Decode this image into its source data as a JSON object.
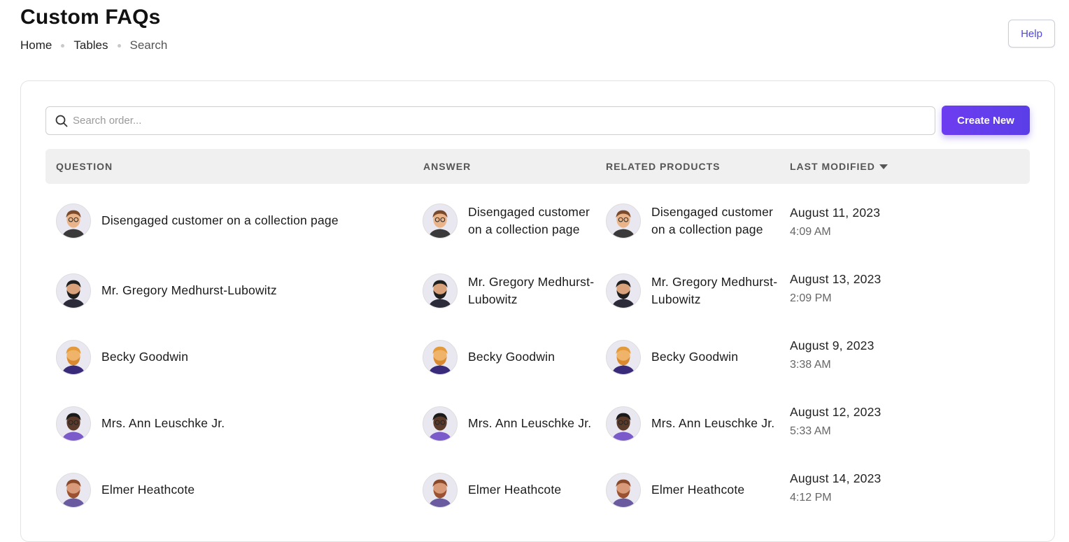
{
  "page": {
    "title": "Custom FAQs",
    "breadcrumb": [
      "Home",
      "Tables",
      "Search"
    ],
    "help_label": "Help"
  },
  "toolbar": {
    "search_placeholder": "Search order...",
    "create_label": "Create New"
  },
  "table": {
    "columns": [
      "QUESTION",
      "ANSWER",
      "RELATED PRODUCTS",
      "LAST MODIFIED"
    ],
    "rows": [
      {
        "question": "Disengaged customer on a collection page",
        "answer": "Disengaged customer on a collection page",
        "related": "Disengaged customer on a collection page",
        "date": "August 11, 2023",
        "time": "4:09 AM",
        "avatar": "man-brown-hair-glasses"
      },
      {
        "question": "Mr. Gregory Medhurst-Lubowitz",
        "answer": "Mr. Gregory Medhurst-Lubowitz",
        "related": "Mr. Gregory Medhurst-Lubowitz",
        "date": "August 13, 2023",
        "time": "2:09 PM",
        "avatar": "man-black-beard"
      },
      {
        "question": "Becky Goodwin",
        "answer": "Becky Goodwin",
        "related": "Becky Goodwin",
        "date": "August 9, 2023",
        "time": "3:38 AM",
        "avatar": "man-blond-beard"
      },
      {
        "question": "Mrs. Ann Leuschke Jr.",
        "answer": "Mrs. Ann Leuschke Jr.",
        "related": "Mrs. Ann Leuschke Jr.",
        "date": "August 12, 2023",
        "time": "5:33 AM",
        "avatar": "man-dark-skin-glasses"
      },
      {
        "question": "Elmer Heathcote",
        "answer": "Elmer Heathcote",
        "related": "Elmer Heathcote",
        "date": "August 14, 2023",
        "time": "4:12 PM",
        "avatar": "man-ginger-beard"
      }
    ]
  },
  "colors": {
    "accent": "#5b3ee8",
    "help_text": "#4f46e5",
    "header_bg": "#f0f0f0"
  }
}
